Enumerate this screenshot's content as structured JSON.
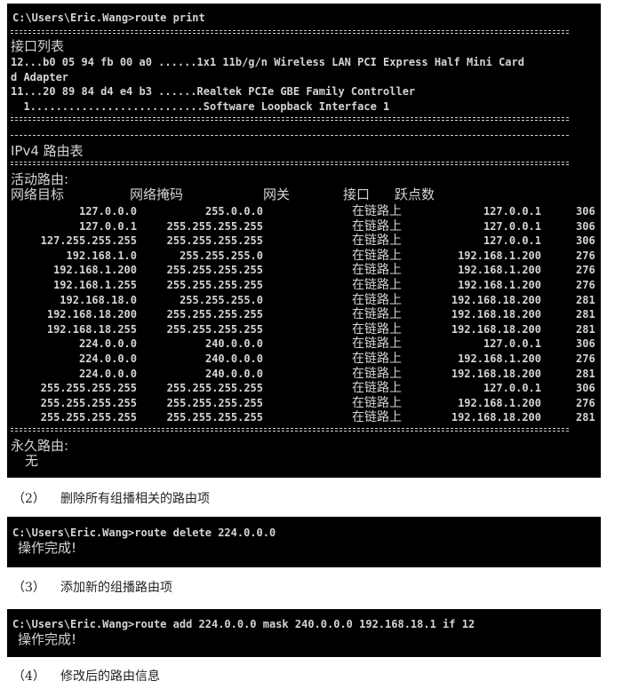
{
  "terminal1": {
    "prompt": "C:\\Users\\Eric.Wang>route print",
    "interface_title": "接口列表",
    "interfaces": [
      "12...b0 05 94 fb 00 a0 ......1x1 11b/g/n Wireless LAN PCI Express Half Mini Card",
      "d Adapter",
      "11...20 89 84 d4 e4 b3 ......Realtek PCIe GBE Family Controller",
      "  1...........................Software Loopback Interface 1"
    ],
    "ipv4_title": "IPv4 路由表",
    "active_title": "活动路由:",
    "headers": {
      "dest": "网络目标",
      "mask": "网络掩码",
      "gateway": "网关",
      "iface": "接口",
      "metric": "跃点数"
    },
    "routes": [
      {
        "dest": "127.0.0.0",
        "mask": "255.0.0.0",
        "gateway": "在链路上",
        "iface": "127.0.0.1",
        "metric": "306"
      },
      {
        "dest": "127.0.0.1",
        "mask": "255.255.255.255",
        "gateway": "在链路上",
        "iface": "127.0.0.1",
        "metric": "306"
      },
      {
        "dest": "127.255.255.255",
        "mask": "255.255.255.255",
        "gateway": "在链路上",
        "iface": "127.0.0.1",
        "metric": "306"
      },
      {
        "dest": "192.168.1.0",
        "mask": "255.255.255.0",
        "gateway": "在链路上",
        "iface": "192.168.1.200",
        "metric": "276"
      },
      {
        "dest": "192.168.1.200",
        "mask": "255.255.255.255",
        "gateway": "在链路上",
        "iface": "192.168.1.200",
        "metric": "276"
      },
      {
        "dest": "192.168.1.255",
        "mask": "255.255.255.255",
        "gateway": "在链路上",
        "iface": "192.168.1.200",
        "metric": "276"
      },
      {
        "dest": "192.168.18.0",
        "mask": "255.255.255.0",
        "gateway": "在链路上",
        "iface": "192.168.18.200",
        "metric": "281"
      },
      {
        "dest": "192.168.18.200",
        "mask": "255.255.255.255",
        "gateway": "在链路上",
        "iface": "192.168.18.200",
        "metric": "281"
      },
      {
        "dest": "192.168.18.255",
        "mask": "255.255.255.255",
        "gateway": "在链路上",
        "iface": "192.168.18.200",
        "metric": "281"
      },
      {
        "dest": "224.0.0.0",
        "mask": "240.0.0.0",
        "gateway": "在链路上",
        "iface": "127.0.0.1",
        "metric": "306"
      },
      {
        "dest": "224.0.0.0",
        "mask": "240.0.0.0",
        "gateway": "在链路上",
        "iface": "192.168.1.200",
        "metric": "276"
      },
      {
        "dest": "224.0.0.0",
        "mask": "240.0.0.0",
        "gateway": "在链路上",
        "iface": "192.168.18.200",
        "metric": "281"
      },
      {
        "dest": "255.255.255.255",
        "mask": "255.255.255.255",
        "gateway": "在链路上",
        "iface": "127.0.0.1",
        "metric": "306"
      },
      {
        "dest": "255.255.255.255",
        "mask": "255.255.255.255",
        "gateway": "在链路上",
        "iface": "192.168.1.200",
        "metric": "276"
      },
      {
        "dest": "255.255.255.255",
        "mask": "255.255.255.255",
        "gateway": "在链路上",
        "iface": "192.168.18.200",
        "metric": "281"
      }
    ],
    "persistent_title": "永久路由:",
    "persistent_value": "无"
  },
  "captions": [
    {
      "num": "（2）",
      "text": "删除所有组播相关的路由项"
    },
    {
      "num": "（3）",
      "text": "添加新的组播路由项"
    },
    {
      "num": "（4）",
      "text": "修改后的路由信息"
    }
  ],
  "terminal2": {
    "prompt": "C:\\Users\\Eric.Wang>route delete 224.0.0.0",
    "result": "操作完成!"
  },
  "terminal3": {
    "prompt": "C:\\Users\\Eric.Wang>route add 224.0.0.0 mask 240.0.0.0 192.168.18.1 if 12",
    "result": "操作完成!"
  }
}
